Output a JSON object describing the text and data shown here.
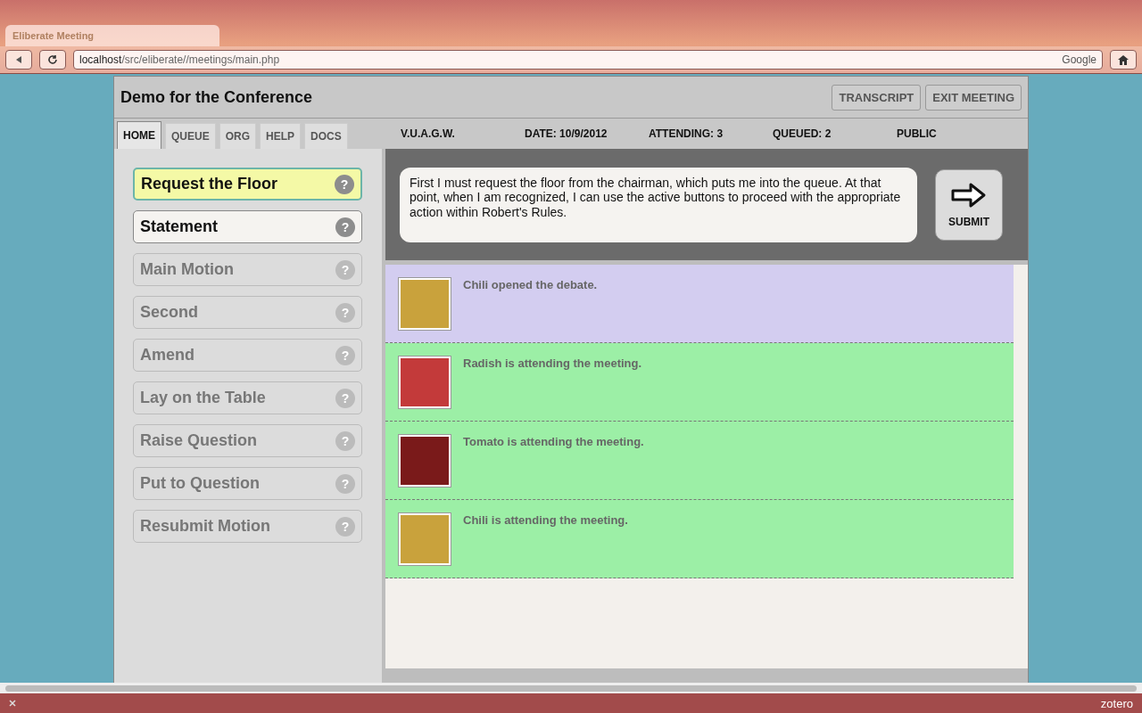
{
  "browser": {
    "tab_title": "Eliberate Meeting",
    "url_host": "localhost",
    "url_path": "/src/eliberate//meetings/main.php",
    "search_engine": "Google",
    "status_addon": "zotero"
  },
  "app": {
    "title": "Demo for the Conference",
    "header_buttons": [
      "TRANSCRIPT",
      "EXIT MEETING"
    ]
  },
  "tabs": [
    {
      "label": "HOME",
      "selected": true
    },
    {
      "label": "QUEUE",
      "selected": false
    },
    {
      "label": "ORG",
      "selected": false
    },
    {
      "label": "HELP",
      "selected": false
    },
    {
      "label": "DOCS",
      "selected": false
    }
  ],
  "info": [
    "V.U.A.G.W.",
    "DATE: 10/9/2012",
    "ATTENDING: 3",
    "QUEUED: 2",
    "PUBLIC"
  ],
  "actions": [
    {
      "label": "Request the Floor",
      "selected": true,
      "disabled": false
    },
    {
      "label": "Statement",
      "selected": false,
      "disabled": false
    },
    {
      "label": "Main Motion",
      "selected": false,
      "disabled": true
    },
    {
      "label": "Second",
      "selected": false,
      "disabled": true
    },
    {
      "label": "Amend",
      "selected": false,
      "disabled": true
    },
    {
      "label": "Lay on the Table",
      "selected": false,
      "disabled": true
    },
    {
      "label": "Raise Question",
      "selected": false,
      "disabled": true
    },
    {
      "label": "Put to Question",
      "selected": false,
      "disabled": true
    },
    {
      "label": "Resubmit Motion",
      "selected": false,
      "disabled": true
    }
  ],
  "help_mark": "?",
  "message": "First I must request the floor from the chairman, which puts me into the queue. At that point, when I am recognized, I can use the active buttons to proceed with the appropriate action within Robert's Rules.",
  "submit_label": "SUBMIT",
  "feed": [
    {
      "text": "Chili opened the debate.",
      "color": "#d3cdf0"
    },
    {
      "text": "Radish is attending the meeting.",
      "color": "#9cefa6"
    },
    {
      "text": "Tomato is attending the meeting.",
      "color": "#9cefa6"
    },
    {
      "text": "Chili is attending the meeting.",
      "color": "#9cefa6"
    }
  ]
}
